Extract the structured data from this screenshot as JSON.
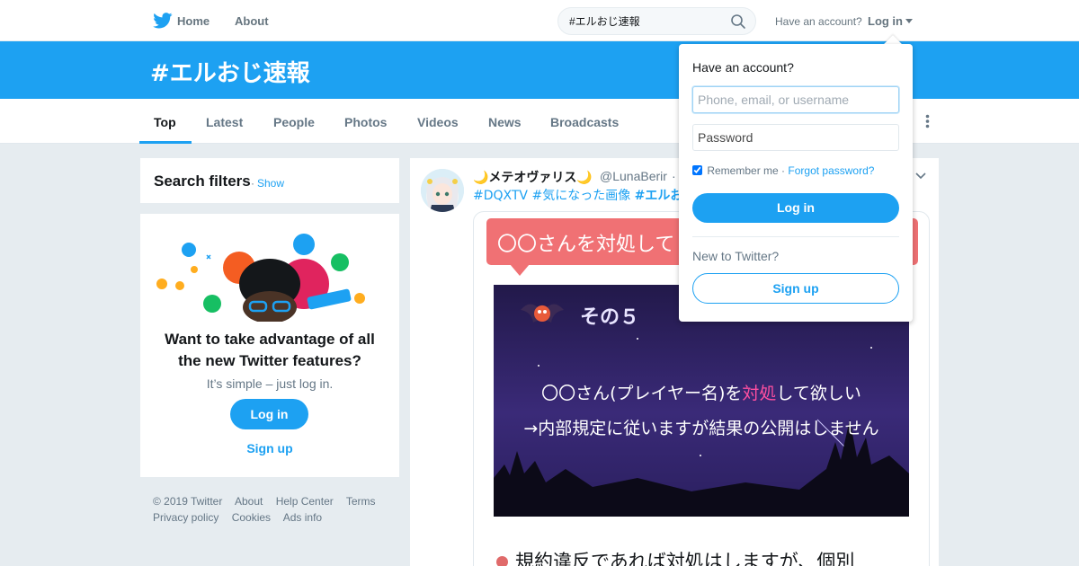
{
  "topbar": {
    "home_label": "Home",
    "about_label": "About",
    "search_value": "#エルおじ速報",
    "have_account": "Have an account?",
    "login_label": "Log in"
  },
  "banner": {
    "title": "#エルおじ速報"
  },
  "tabs": [
    {
      "label": "Top",
      "active": true
    },
    {
      "label": "Latest"
    },
    {
      "label": "People"
    },
    {
      "label": "Photos"
    },
    {
      "label": "Videos"
    },
    {
      "label": "News"
    },
    {
      "label": "Broadcasts"
    }
  ],
  "filters": {
    "title": "Search filters",
    "separator": "·",
    "show_label": "Show"
  },
  "promo": {
    "heading": "Want to take advantage of all the new Twitter features?",
    "subtext": "It’s simple – just log in.",
    "login_label": "Log in",
    "signup_label": "Sign up"
  },
  "footer": [
    "© 2019 Twitter",
    "About",
    "Help Center",
    "Terms",
    "Privacy policy",
    "Cookies",
    "Ads info"
  ],
  "tweet": {
    "name": "🌙メテオヴァリス🌙",
    "handle": "@LunaBerir",
    "dot": "·",
    "tag1": "#DQXTV",
    "tag2": "#気になった画像",
    "tag3": "#エルおじ",
    "media": {
      "callout": "〇〇さんを対処して",
      "sono": "その５",
      "line1_a": "〇〇さん(プレイヤー名)を",
      "line1_hl": "対処",
      "line1_b": "して欲しい",
      "line2": "→内部規定に従いますが結果の公開はしません",
      "bullet": "規約違反であれば対処はしますが、個別"
    }
  },
  "dropdown": {
    "title": "Have an account?",
    "username_placeholder": "Phone, email, or username",
    "password_placeholder": "Password",
    "remember": "Remember me",
    "separator": "·",
    "forgot": "Forgot password?",
    "login_label": "Log in",
    "new_label": "New to Twitter?",
    "signup_label": "Sign up"
  },
  "colors": {
    "brand": "#1da1f2",
    "background": "#e6ecf0",
    "callout": "#f07174",
    "highlight": "#ff4fa0"
  }
}
